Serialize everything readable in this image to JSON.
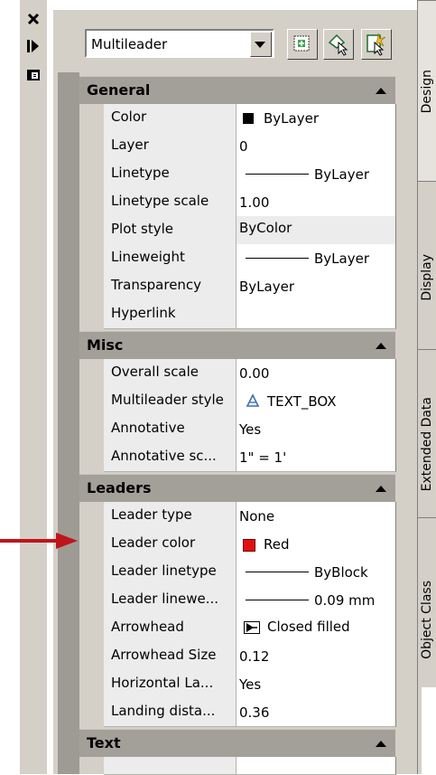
{
  "toolbar": {
    "selector_value": "Multileader"
  },
  "sections": [
    {
      "title": "General",
      "rows": [
        {
          "name": "Color",
          "value": "ByLayer",
          "swatch": "#000000"
        },
        {
          "name": "Layer",
          "value": "0"
        },
        {
          "name": "Linetype",
          "value": "ByLayer",
          "line": true
        },
        {
          "name": "Linetype scale",
          "value": "1.00"
        },
        {
          "name": "Plot style",
          "value": "ByColor"
        },
        {
          "name": "Lineweight",
          "value": "ByLayer",
          "line": true
        },
        {
          "name": "Transparency",
          "value": "ByLayer"
        },
        {
          "name": "Hyperlink",
          "value": ""
        }
      ]
    },
    {
      "title": "Misc",
      "rows": [
        {
          "name": "Overall scale",
          "value": "0.00"
        },
        {
          "name": "Multileader style",
          "value": "TEXT_BOX",
          "icon": "annotative-icon"
        },
        {
          "name": "Annotative",
          "value": "Yes"
        },
        {
          "name": "Annotative sc...",
          "value": "1\" = 1'"
        }
      ]
    },
    {
      "title": "Leaders",
      "rows": [
        {
          "name": "Leader type",
          "value": "None"
        },
        {
          "name": "Leader color",
          "value": "Red",
          "swatch": "#e01010"
        },
        {
          "name": "Leader linetype",
          "value": "ByBlock",
          "line": true
        },
        {
          "name": "Leader linewe...",
          "value": "0.09 mm",
          "line": true
        },
        {
          "name": "Arrowhead",
          "value": "Closed filled",
          "icon": "closed-filled-arrow-icon"
        },
        {
          "name": "Arrowhead Size",
          "value": "0.12"
        },
        {
          "name": "Horizontal La...",
          "value": "Yes"
        },
        {
          "name": "Landing dista...",
          "value": "0.36"
        }
      ]
    },
    {
      "title": "Text",
      "rows": []
    }
  ],
  "tabs": [
    "Design",
    "Display",
    "Extended Data",
    "Object Class"
  ],
  "colors": {
    "arrow": "#c0141c",
    "leader_color": "#e01010"
  }
}
